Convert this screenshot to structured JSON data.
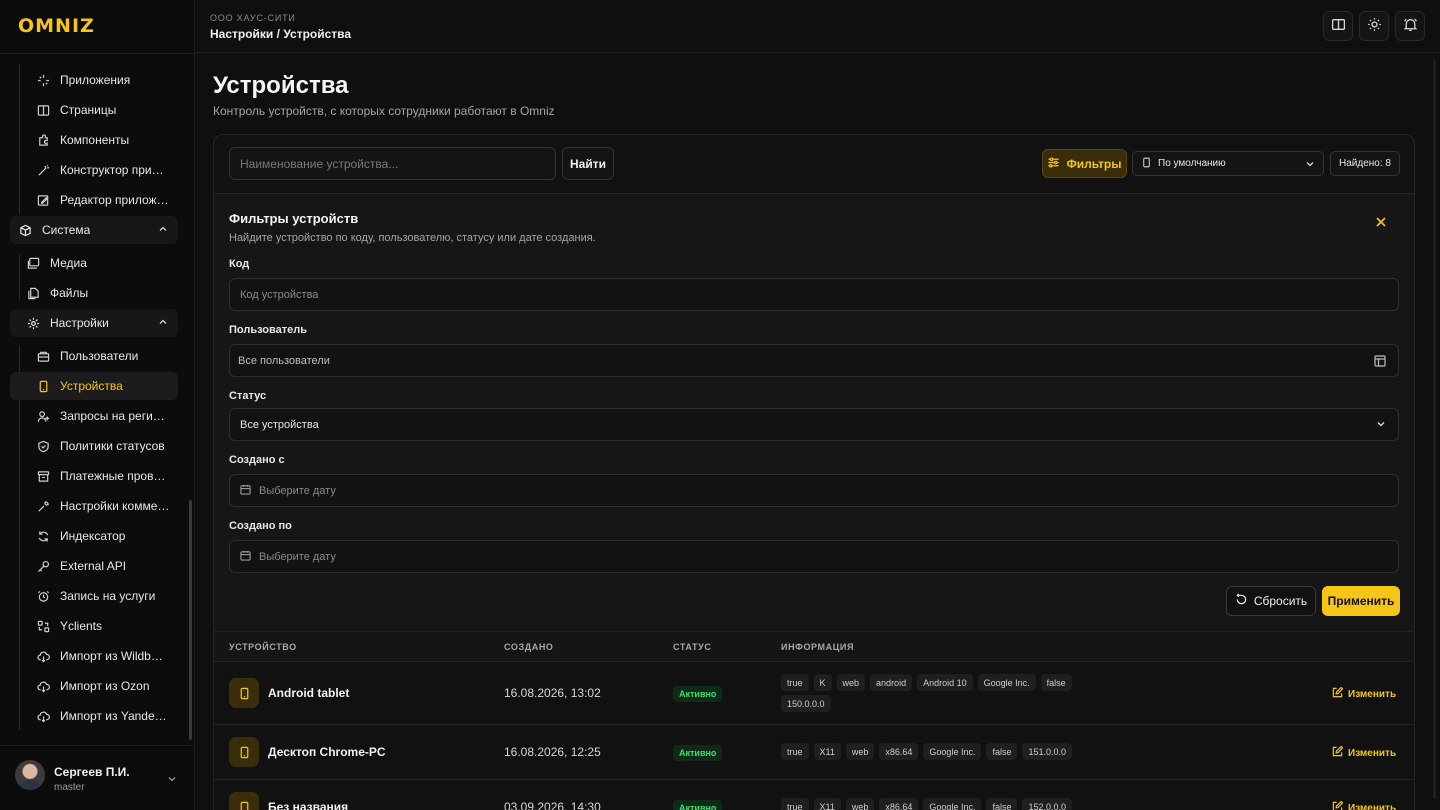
{
  "brand": {
    "logo": "OMNIZ",
    "accent": "#f5c518"
  },
  "header": {
    "org": "ООО ХАУС-СИТИ",
    "breadcrumb": "Настройки / Устройства",
    "icons": [
      "book-icon",
      "sun-icon",
      "bell-icon"
    ]
  },
  "sidebar": {
    "items": [
      {
        "label": "Приложения",
        "icon": "sparkles-icon"
      },
      {
        "label": "Страницы",
        "icon": "book-icon"
      },
      {
        "label": "Компоненты",
        "icon": "puzzle-icon"
      },
      {
        "label": "Конструктор приложений",
        "icon": "wand-icon"
      },
      {
        "label": "Редактор приложений",
        "icon": "edit-icon"
      },
      {
        "label": "Система",
        "icon": "cube-icon"
      },
      {
        "label": "Медиа",
        "icon": "images-icon"
      },
      {
        "label": "Файлы",
        "icon": "files-icon"
      },
      {
        "label": "Настройки",
        "icon": "gear-icon"
      },
      {
        "label": "Пользователи",
        "icon": "users-card-icon"
      },
      {
        "label": "Устройства",
        "icon": "phone-icon"
      },
      {
        "label": "Запросы на регистрацию",
        "icon": "user-plus-icon"
      },
      {
        "label": "Политики статусов",
        "icon": "shield-icon"
      },
      {
        "label": "Платежные провайдеры",
        "icon": "archive-icon"
      },
      {
        "label": "Настройки коммерции",
        "icon": "tools-icon"
      },
      {
        "label": "Индексатор",
        "icon": "refresh-icon"
      },
      {
        "label": "External API",
        "icon": "key-icon"
      },
      {
        "label": "Запись на услуги",
        "icon": "alarm-icon"
      },
      {
        "label": "Yclients",
        "icon": "swap-icon"
      },
      {
        "label": "Импорт из Wildberries",
        "icon": "cloud-import-icon"
      },
      {
        "label": "Импорт из Ozon",
        "icon": "cloud-import-icon"
      },
      {
        "label": "Импорт из Yandex Market",
        "icon": "cloud-import-icon"
      }
    ],
    "user": {
      "name": "Сергеев П.И.",
      "role": "master"
    }
  },
  "page": {
    "title": "Устройства",
    "subtitle": "Контроль устройств, с которых сотрудники работают в Omniz"
  },
  "toolbar": {
    "search_placeholder": "Наименование устройства...",
    "search_button": "Найти",
    "filters_button": "Фильтры",
    "sort_value": "По умолчанию",
    "found": "Найдено: 8"
  },
  "filters": {
    "title": "Фильтры устройств",
    "subtitle": "Найдите устройство по коду, пользователю, статусу или дате создания.",
    "code_label": "Код",
    "code_placeholder": "Код устройства",
    "user_label": "Пользователь",
    "user_value": "Все пользователи",
    "status_label": "Статус",
    "status_value": "Все устройства",
    "created_from_label": "Создано с",
    "created_from_placeholder": "Выберите дату",
    "created_to_label": "Создано по",
    "created_to_placeholder": "Выберите дату",
    "reset_button": "Сбросить",
    "apply_button": "Применить"
  },
  "table": {
    "columns": [
      "УСТРОЙСТВО",
      "СОЗДАНО",
      "СТАТУС",
      "ИНФОРМАЦИЯ"
    ],
    "edit_label": "Изменить",
    "rows": [
      {
        "name": "Android tablet",
        "created": "16.08.2026, 13:02",
        "status": "Активно",
        "tags": [
          "true",
          "K",
          "web",
          "android",
          "Android 10",
          "Google Inc.",
          "false",
          "150.0.0.0"
        ]
      },
      {
        "name": "Десктоп Chrome-PC",
        "created": "16.08.2026, 12:25",
        "status": "Активно",
        "tags": [
          "true",
          "X11",
          "web",
          "x86.64",
          "Google Inc.",
          "false",
          "151.0.0.0"
        ]
      },
      {
        "name": "Без названия",
        "created": "03.09.2026, 14:30",
        "status": "Активно",
        "tags": [
          "true",
          "X11",
          "web",
          "x86.64",
          "Google Inc.",
          "false",
          "152.0.0.0"
        ]
      }
    ]
  }
}
